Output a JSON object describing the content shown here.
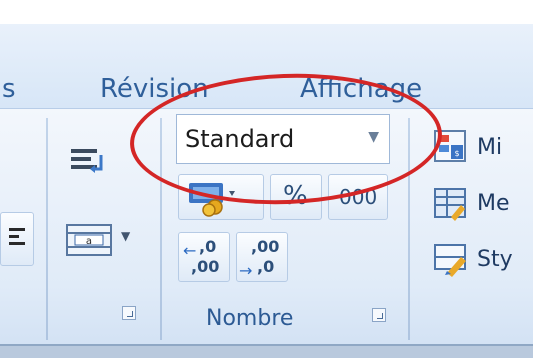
{
  "tabs": {
    "prev_fragment": "s",
    "revision": "Révision",
    "affichage": "Affichage"
  },
  "number_group": {
    "label": "Nombre",
    "format_combo_value": "Standard",
    "percent_label": "%",
    "thousands_label": "000",
    "increase_decimal_top": ",0",
    "increase_decimal_bottom": ",00",
    "decrease_decimal_top": ",00",
    "decrease_decimal_bottom": ",0"
  },
  "styles_group": {
    "item1_fragment": "Mi",
    "item2_fragment": "Me",
    "item3_fragment": "Sty"
  },
  "colors": {
    "highlight": "#d42626",
    "tab_text": "#2f5f9a"
  }
}
